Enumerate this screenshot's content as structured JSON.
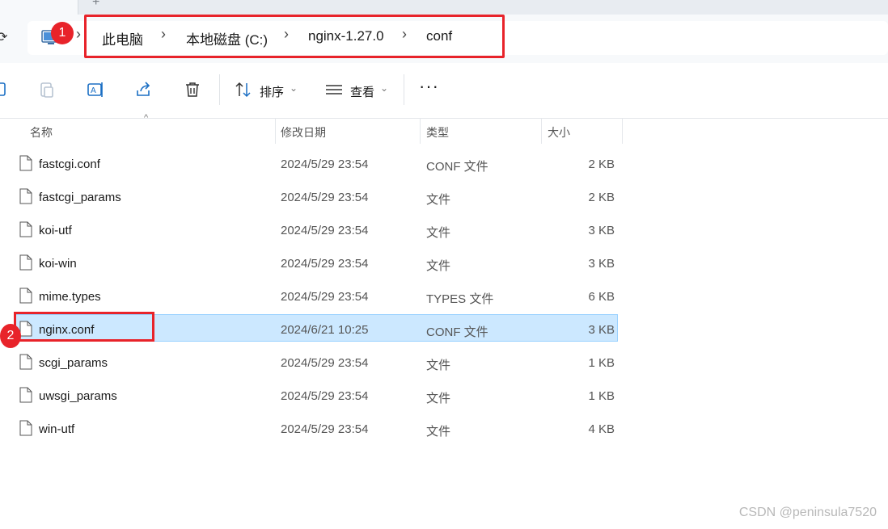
{
  "address_bar": {
    "breadcrumbs": [
      "此电脑",
      "本地磁盘 (C:)",
      "nginx-1.27.0",
      "conf"
    ],
    "separator": "›",
    "icon": "computer-icon"
  },
  "badges": {
    "badge1": "1",
    "badge2": "2"
  },
  "toolbar": {
    "sort_label": "排序",
    "view_label": "查看",
    "more_label": "···",
    "icons": [
      "copy-icon",
      "paste-icon",
      "rename-icon",
      "share-icon",
      "delete-icon",
      "sort-icon",
      "view-icon"
    ]
  },
  "columns": {
    "name": "名称",
    "date": "修改日期",
    "type": "类型",
    "size": "大小"
  },
  "files": [
    {
      "name": "fastcgi.conf",
      "date": "2024/5/29 23:54",
      "type": "CONF 文件",
      "size": "2 KB"
    },
    {
      "name": "fastcgi_params",
      "date": "2024/5/29 23:54",
      "type": "文件",
      "size": "2 KB"
    },
    {
      "name": "koi-utf",
      "date": "2024/5/29 23:54",
      "type": "文件",
      "size": "3 KB"
    },
    {
      "name": "koi-win",
      "date": "2024/5/29 23:54",
      "type": "文件",
      "size": "3 KB"
    },
    {
      "name": "mime.types",
      "date": "2024/5/29 23:54",
      "type": "TYPES 文件",
      "size": "6 KB"
    },
    {
      "name": "nginx.conf",
      "date": "2024/6/21 10:25",
      "type": "CONF 文件",
      "size": "3 KB",
      "selected": true
    },
    {
      "name": "scgi_params",
      "date": "2024/5/29 23:54",
      "type": "文件",
      "size": "1 KB"
    },
    {
      "name": "uwsgi_params",
      "date": "2024/5/29 23:54",
      "type": "文件",
      "size": "1 KB"
    },
    {
      "name": "win-utf",
      "date": "2024/5/29 23:54",
      "type": "文件",
      "size": "4 KB"
    }
  ],
  "watermark": "CSDN @peninsula7520",
  "colors": {
    "selection": "#cce8ff",
    "annotation_red": "#e8232a"
  }
}
